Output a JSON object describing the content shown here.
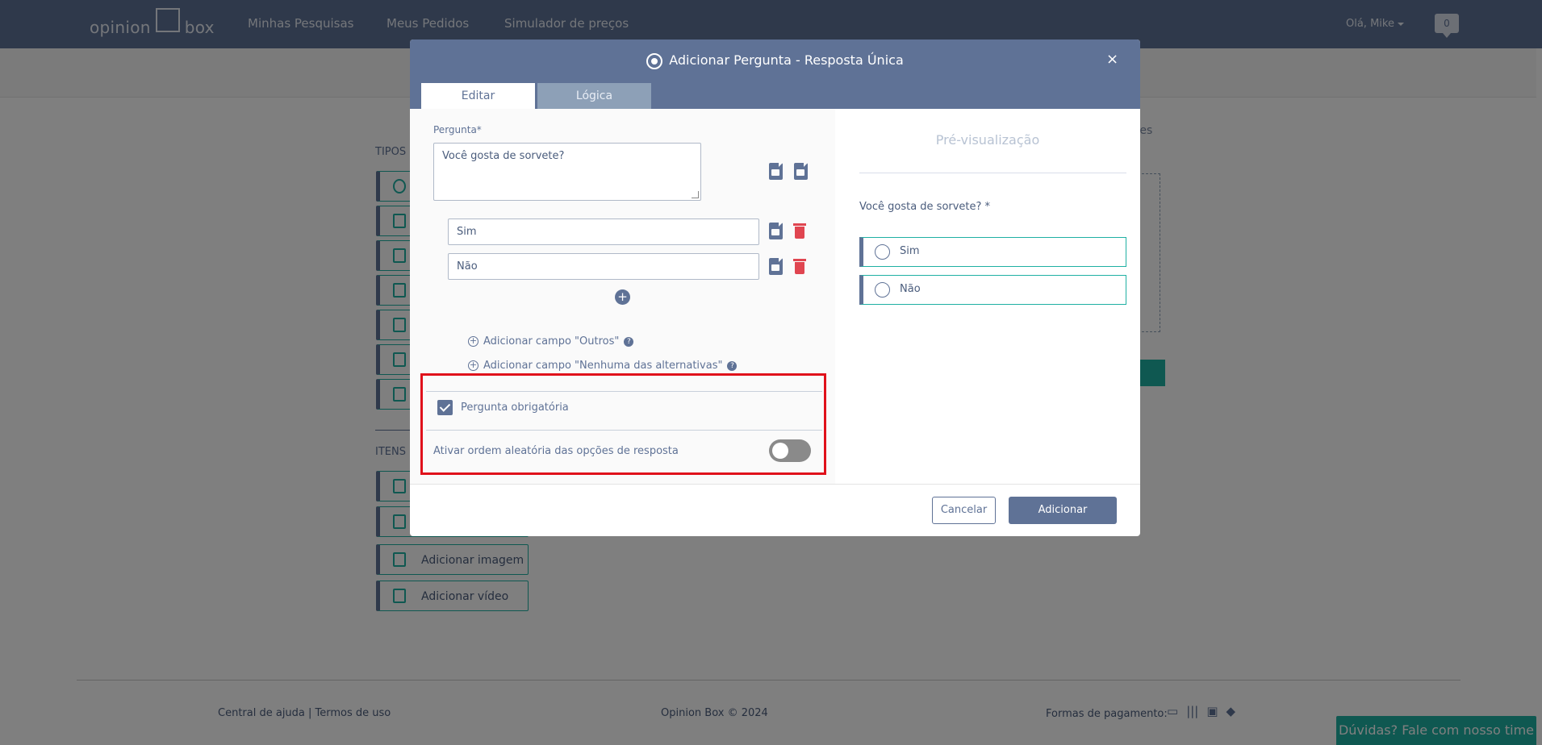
{
  "navbar": {
    "brand_left": "opinion",
    "brand_right": "box",
    "links": [
      "Minhas Pesquisas",
      "Meus Pedidos",
      "Simulador de preços"
    ],
    "user_greeting": "Olá, Mike",
    "notifications_count": "0"
  },
  "background": {
    "section_types_label": "TIPOS D",
    "section_items_label": "ITENS D",
    "right_text": "ntes",
    "tiles_items": [
      "Adicionar imagem",
      "Adicionar vídeo"
    ]
  },
  "footer": {
    "help_links": "Central de ajuda | Termos de uso",
    "copyright": "Opinion Box © 2024",
    "payment_label": "Formas de pagamento:",
    "help_button": "Dúvidas? Fale com nosso time"
  },
  "modal": {
    "title": "Adicionar Pergunta - Resposta Única",
    "close": "×",
    "tabs": [
      {
        "label": "Editar",
        "active": true
      },
      {
        "label": "Lógica",
        "active": false
      }
    ],
    "question_label": "Pergunta*",
    "question_value": "Você gosta de sorvete?",
    "answers": [
      "Sim",
      "Não"
    ],
    "add_other": "Adicionar campo \"Outros\"",
    "add_none": "Adicionar campo \"Nenhuma das alternativas\"",
    "required_label": "Pergunta obrigatória",
    "required_checked": true,
    "random_order_label": "Ativar ordem aleatória das opções de resposta",
    "random_order_on": false,
    "preview": {
      "title": "Pré-visualização",
      "question": "Você gosta de sorvete? *",
      "options": [
        "Sim",
        "Não"
      ]
    },
    "cancel_button": "Cancelar",
    "add_button": "Adicionar"
  },
  "colors": {
    "primary": "#5f7296",
    "accent": "#1fb0a3",
    "danger": "#e04550",
    "highlight": "#e0111b"
  }
}
